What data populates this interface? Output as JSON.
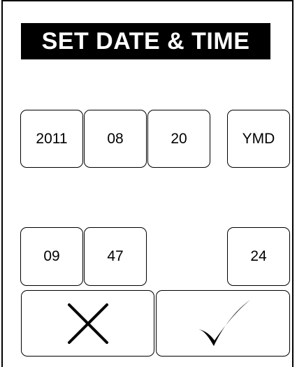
{
  "title": "SET DATE & TIME",
  "date": {
    "year": "2011",
    "month": "08",
    "day": "20",
    "format": "YMD"
  },
  "time": {
    "hour": "09",
    "minute": "47",
    "mode": "24"
  },
  "actions": {
    "cancel_icon": "close-icon",
    "confirm_icon": "checkmark-icon"
  }
}
